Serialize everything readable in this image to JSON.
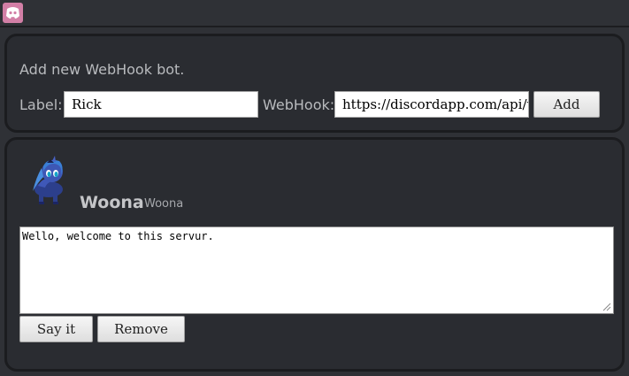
{
  "app": {
    "icon": "discord-logo-icon"
  },
  "add_panel": {
    "heading": "Add new WebHook bot.",
    "label_text": "Label:",
    "label_value": "Rick",
    "webhook_text": "WebHook:",
    "webhook_value": "https://discordapp.com/api/webhook",
    "add_label": "Add"
  },
  "bot": {
    "avatar_icon": "pony-avatar-icon",
    "name": "Woona",
    "label": "Woona",
    "message": "Wello, welcome to this servur.",
    "say_label": "Say it",
    "remove_label": "Remove"
  }
}
